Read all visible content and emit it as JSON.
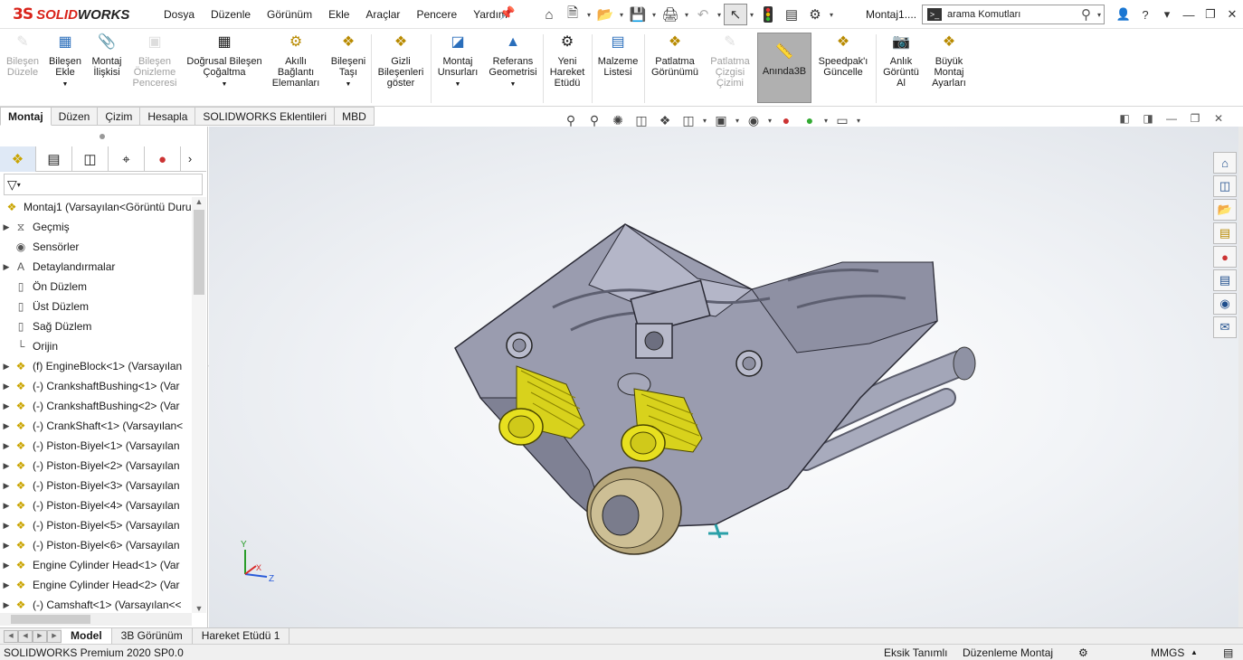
{
  "app": {
    "brand_prefix": "3S",
    "brand_main": "SOLID",
    "brand_bold": "WORKS"
  },
  "menu": [
    "Dosya",
    "Düzenle",
    "Görünüm",
    "Ekle",
    "Araçlar",
    "Pencere",
    "Yardım"
  ],
  "document_title": "Montaj1....",
  "search": {
    "prefix": ">_",
    "value": "arama Komutları"
  },
  "ribbon": [
    {
      "label1": "Bileşen",
      "label2": "Düzele",
      "label3": "",
      "icon": "edit-component-icon",
      "disabled": true,
      "dropdown": false
    },
    {
      "label1": "Bileşen",
      "label2": "Ekle",
      "label3": "",
      "icon": "insert-component-icon",
      "disabled": false,
      "dropdown": true
    },
    {
      "label1": "Montaj",
      "label2": "İlişkisi",
      "label3": "",
      "icon": "mate-icon",
      "disabled": false,
      "dropdown": false
    },
    {
      "label1": "Bileşen",
      "label2": "Önizleme",
      "label3": "Penceresi",
      "icon": "component-preview-icon",
      "disabled": true,
      "dropdown": false
    },
    {
      "label1": "Doğrusal Bileşen",
      "label2": "Çoğaltma",
      "label3": "",
      "icon": "linear-pattern-icon",
      "disabled": false,
      "dropdown": true
    },
    {
      "label1": "Akıllı",
      "label2": "Bağlantı",
      "label3": "Elemanları",
      "icon": "smart-fasteners-icon",
      "disabled": false,
      "dropdown": false
    },
    {
      "label1": "Bileşeni",
      "label2": "Taşı",
      "label3": "",
      "icon": "move-component-icon",
      "disabled": false,
      "dropdown": true
    },
    {
      "label1": "Gizli",
      "label2": "Bileşenleri",
      "label3": "göster",
      "icon": "show-hidden-icon",
      "disabled": false,
      "dropdown": false
    },
    {
      "label1": "Montaj",
      "label2": "Unsurları",
      "label3": "",
      "icon": "assembly-features-icon",
      "disabled": false,
      "dropdown": true
    },
    {
      "label1": "Referans",
      "label2": "Geometrisi",
      "label3": "",
      "icon": "reference-geometry-icon",
      "disabled": false,
      "dropdown": true
    },
    {
      "label1": "Yeni",
      "label2": "Hareket",
      "label3": "Etüdü",
      "icon": "motion-study-icon",
      "disabled": false,
      "dropdown": false
    },
    {
      "label1": "Malzeme",
      "label2": "Listesi",
      "label3": "",
      "icon": "bill-of-materials-icon",
      "disabled": false,
      "dropdown": false
    },
    {
      "label1": "Patlatma",
      "label2": "Görünümü",
      "label3": "",
      "icon": "exploded-view-icon",
      "disabled": false,
      "dropdown": false
    },
    {
      "label1": "Patlatma",
      "label2": "Çizgisi",
      "label3": "Çizimi",
      "icon": "explode-line-icon",
      "disabled": true,
      "dropdown": false
    },
    {
      "label1": "Anında3B",
      "label2": "",
      "label3": "",
      "icon": "instant3d-icon",
      "disabled": false,
      "dropdown": false,
      "active": true
    },
    {
      "label1": "Speedpak'ı",
      "label2": "Güncelle",
      "label3": "",
      "icon": "speedpak-icon",
      "disabled": false,
      "dropdown": false
    },
    {
      "label1": "Anlık",
      "label2": "Görüntü",
      "label3": "Al",
      "icon": "snapshot-icon",
      "disabled": false,
      "dropdown": false
    },
    {
      "label1": "Büyük",
      "label2": "Montaj",
      "label3": "Ayarları",
      "icon": "large-assembly-icon",
      "disabled": false,
      "dropdown": false
    }
  ],
  "command_tabs": [
    "Montaj",
    "Düzen",
    "Çizim",
    "Hesapla",
    "SOLIDWORKS Eklentileri",
    "MBD"
  ],
  "tree": {
    "root": "Montaj1  (Varsayılan<Görüntü Duru",
    "items": [
      {
        "label": "Geçmiş",
        "icon": "history-icon",
        "expander": true
      },
      {
        "label": "Sensörler",
        "icon": "sensors-icon",
        "expander": false
      },
      {
        "label": "Detaylandırmalar",
        "icon": "annotations-icon",
        "expander": true
      },
      {
        "label": "Ön Düzlem",
        "icon": "plane-icon",
        "expander": false
      },
      {
        "label": "Üst Düzlem",
        "icon": "plane-icon",
        "expander": false
      },
      {
        "label": "Sağ Düzlem",
        "icon": "plane-icon",
        "expander": false
      },
      {
        "label": "Orijin",
        "icon": "origin-icon",
        "expander": false
      },
      {
        "label": "(f) EngineBlock<1> (Varsayılan",
        "icon": "part-icon",
        "expander": true
      },
      {
        "label": "(-) CrankshaftBushing<1> (Var",
        "icon": "part-icon",
        "expander": true
      },
      {
        "label": "(-) CrankshaftBushing<2> (Var",
        "icon": "part-icon",
        "expander": true
      },
      {
        "label": "(-) CrankShaft<1> (Varsayılan<",
        "icon": "part-icon",
        "expander": true
      },
      {
        "label": "(-) Piston-Biyel<1> (Varsayılan",
        "icon": "subassembly-icon",
        "expander": true
      },
      {
        "label": "(-) Piston-Biyel<2> (Varsayılan",
        "icon": "subassembly-icon",
        "expander": true
      },
      {
        "label": "(-) Piston-Biyel<3> (Varsayılan",
        "icon": "subassembly-icon",
        "expander": true
      },
      {
        "label": "(-) Piston-Biyel<4> (Varsayılan",
        "icon": "subassembly-icon",
        "expander": true
      },
      {
        "label": "(-) Piston-Biyel<5> (Varsayılan",
        "icon": "subassembly-icon",
        "expander": true
      },
      {
        "label": "(-) Piston-Biyel<6> (Varsayılan",
        "icon": "subassembly-icon",
        "expander": true
      },
      {
        "label": "Engine Cylinder Head<1> (Var",
        "icon": "part-icon",
        "expander": true
      },
      {
        "label": "Engine Cylinder Head<2> (Var",
        "icon": "part-icon",
        "expander": true
      },
      {
        "label": "(-) Camshaft<1> (Varsayılan<<",
        "icon": "part-icon",
        "expander": true
      }
    ]
  },
  "triad": {
    "x": "X",
    "y": "Y",
    "z": "Z"
  },
  "bottom_tabs": [
    "Model",
    "3B Görünüm",
    "Hareket Etüdü 1"
  ],
  "status": {
    "product": "SOLIDWORKS Premium 2020 SP0.0",
    "definition": "Eksik Tanımlı",
    "mode": "Düzenleme Montaj",
    "units": "MMGS"
  },
  "colors": {
    "accent": "#d9241b",
    "part_yellow": "#e0d51c",
    "engine_gray": "#9a9caf",
    "pulley_tan": "#c9b98e"
  }
}
